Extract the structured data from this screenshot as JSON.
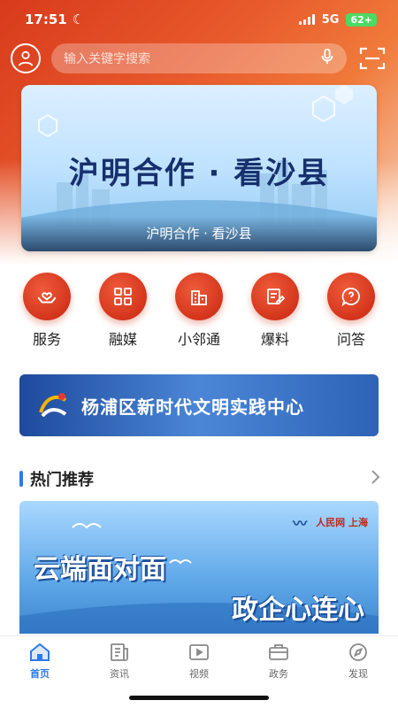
{
  "status": {
    "time": "17:51",
    "network": "5G",
    "battery": "62+"
  },
  "search": {
    "placeholder": "输入关键字搜索"
  },
  "banner": {
    "title": "沪明合作 · 看沙县",
    "caption": "沪明合作 · 看沙县"
  },
  "shortcuts": [
    {
      "label": "服务",
      "icon": "hands-heart-icon"
    },
    {
      "label": "融媒",
      "icon": "grid-icon"
    },
    {
      "label": "小邻通",
      "icon": "building-icon"
    },
    {
      "label": "爆料",
      "icon": "edit-icon"
    },
    {
      "label": "问答",
      "icon": "question-icon"
    }
  ],
  "culture_banner": {
    "text": "杨浦区新时代文明实践中心"
  },
  "section": {
    "title": "热门推荐"
  },
  "feature": {
    "line1": "云端面对面",
    "line2": "政企心连心",
    "logo_right": "人民网 上海"
  },
  "tabs": [
    {
      "label": "首页",
      "active": true
    },
    {
      "label": "资讯",
      "active": false
    },
    {
      "label": "视频",
      "active": false
    },
    {
      "label": "政务",
      "active": false
    },
    {
      "label": "发现",
      "active": false
    }
  ],
  "colors": {
    "accent": "#2f7ae5",
    "brand_red": "#d4351c"
  }
}
